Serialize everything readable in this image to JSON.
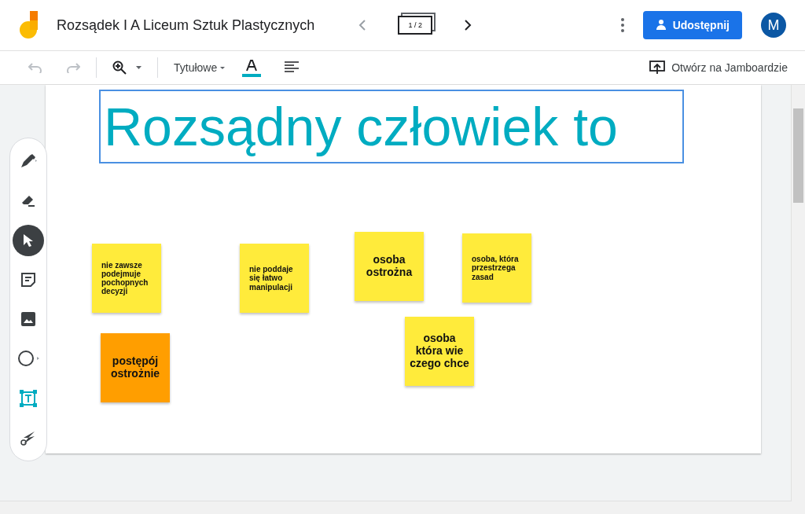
{
  "header": {
    "title": "Rozsądek I A Liceum Sztuk Plastycznych",
    "frame_counter": "1 / 2",
    "share_button": "Udostępnij",
    "avatar": "M"
  },
  "toolbar": {
    "text_style": "Tytułowe",
    "open_button": "Otwórz na Jamboardzie"
  },
  "tools": [
    {
      "kind": "pen",
      "selected": false
    },
    {
      "kind": "eraser",
      "selected": false
    },
    {
      "kind": "select",
      "selected": true
    },
    {
      "kind": "note",
      "selected": false
    },
    {
      "kind": "image",
      "selected": false
    },
    {
      "kind": "circle",
      "selected": false
    },
    {
      "kind": "textbox",
      "selected": false
    },
    {
      "kind": "laser",
      "selected": false
    }
  ],
  "canvas": {
    "title_box": {
      "text": "Rozsądny człowiek to",
      "selected": true
    },
    "notes": [
      {
        "text": "nie zawsze podejmuje pochopnych decyzji",
        "color": "#ffeb3b",
        "kind": "small"
      },
      {
        "text": "nie poddaje się łatwo manipulacji",
        "color": "#ffeb3b",
        "kind": "small"
      },
      {
        "text": "osoba ostrożna",
        "color": "#ffeb3b",
        "kind": "large"
      },
      {
        "text": "osoba, która przestrzega zasad",
        "color": "#ffeb3b",
        "kind": "small"
      },
      {
        "text": "osoba która wie czego chce",
        "color": "#ffeb3b",
        "kind": "large"
      },
      {
        "text": "postępój ostrożnie",
        "color": "#ff9e00",
        "kind": "large"
      }
    ]
  }
}
